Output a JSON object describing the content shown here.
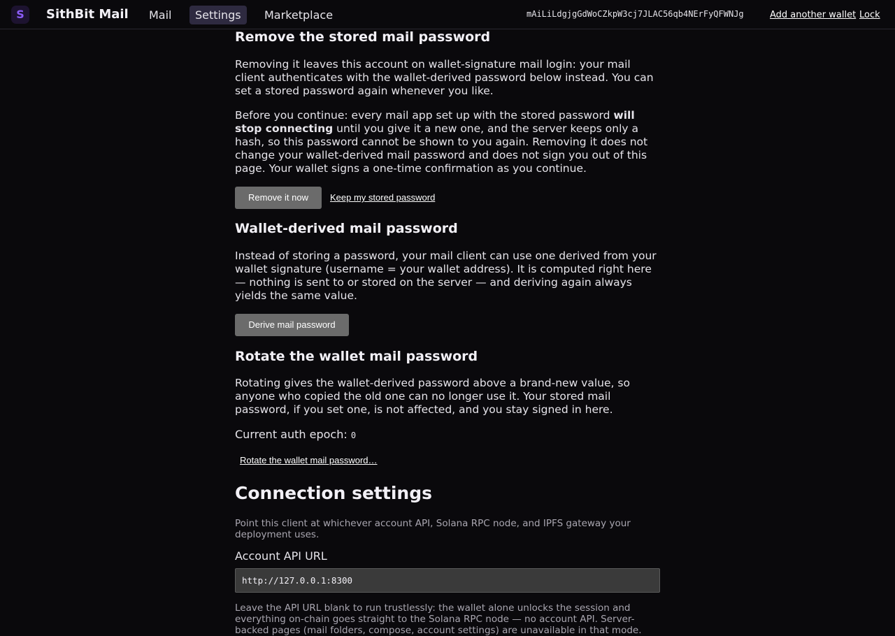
{
  "topbar": {
    "logo_letter": "S",
    "brand": "SithBit Mail",
    "nav": {
      "mail": "Mail",
      "settings": "Settings",
      "marketplace": "Marketplace"
    },
    "wallet_address": "mAiLiLdgjgGdWoCZkpW3cj7JLAC56qb4NErFyQFWNJg",
    "add_wallet": "Add another wallet",
    "lock": "Lock"
  },
  "remove_section": {
    "heading": "Remove the stored mail password",
    "para1": "Removing it leaves this account on wallet-signature mail login: your mail client authenticates with the wallet-derived password below instead. You can set a stored password again whenever you like.",
    "para2_before": "Before you continue: every mail app set up with the stored password ",
    "para2_bold": "will stop connecting",
    "para2_after": " until you give it a new one, and the server keeps only a hash, so this password cannot be shown to you again. Removing it does not change your wallet-derived mail password and does not sign you out of this page. Your wallet signs a one-time confirmation as you continue.",
    "remove_button": "Remove it now",
    "keep_link": "Keep my stored password"
  },
  "derived_section": {
    "heading": "Wallet-derived mail password",
    "para": "Instead of storing a password, your mail client can use one derived from your wallet signature (username = your wallet address). It is computed right here — nothing is sent to or stored on the server — and deriving again always yields the same value.",
    "derive_button": "Derive mail password"
  },
  "rotate_section": {
    "heading": "Rotate the wallet mail password",
    "para": "Rotating gives the wallet-derived password above a brand-new value, so anyone who copied the old one can no longer use it. Your stored mail password, if you set one, is not affected, and you stay signed in here.",
    "epoch_label": "Current auth epoch: ",
    "epoch_value": "0",
    "rotate_link": "Rotate the wallet mail password…"
  },
  "connection_section": {
    "heading": "Connection settings",
    "description": "Point this client at whichever account API, Solana RPC node, and IPFS gateway your deployment uses.",
    "api_label": "Account API URL",
    "api_value": "http://127.0.0.1:8300",
    "api_help": "Leave the API URL blank to run trustlessly: the wallet alone unlocks the session and everything on-chain goes straight to the Solana RPC node — no account API. Server-backed pages (mail folders, compose, account settings) are unavailable in that mode."
  }
}
